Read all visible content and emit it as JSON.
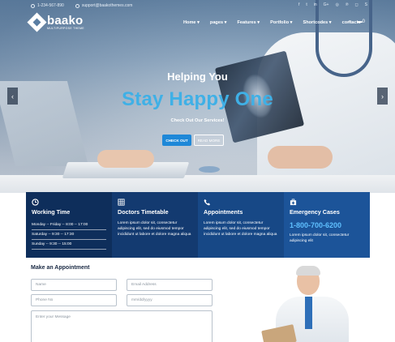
{
  "topbar": {
    "phone": "1-234-567-890",
    "email": "support@baakothemes.com",
    "social_icons": [
      "facebook-icon",
      "twitter-icon",
      "linkedin-icon",
      "google-plus-icon",
      "github-icon",
      "pinterest-icon",
      "instagram-icon",
      "skype-icon"
    ],
    "social_glyphs": [
      "f",
      "t",
      "in",
      "G+",
      "◎",
      "℗",
      "◻",
      "S"
    ]
  },
  "logo": {
    "name": "baako",
    "tagline": "MULTIPURPOSE THEME"
  },
  "nav": {
    "items": [
      "Home ▾",
      "pages ▾",
      "Features ▾",
      "Portfolio ▾",
      "Shortcodes ▾",
      "contacts"
    ],
    "cart_count": "0",
    "search_glyph": "⌕",
    "cart_glyph": "🛒"
  },
  "hero": {
    "subtitle": "Helping You",
    "title": "Stay Happy One",
    "cta_text": "Check Out Our Services!",
    "btn_primary": "CHECK OUT",
    "btn_secondary": "READ MORE",
    "prev_glyph": "‹",
    "next_glyph": "›"
  },
  "info": {
    "working": {
      "title": "Working Time",
      "rows": [
        "Monday -- Friday -- 8:00 -- 17:00",
        "Saturday -- 9:30 -- 17:30",
        "Sunday -- 9:30 -- 15:00"
      ]
    },
    "timetable": {
      "title": "Doctors Timetable",
      "text": "Lorem ipsum dolor sit, consectetur adipiscing elit, sed do eiusmod tempor incididunt ut labore et dolore magna aliqua"
    },
    "appointments": {
      "title": "Appointments",
      "text": "Lorem ipsum dolor sit, consectetur adipiscing elit, sed do eiusmod tempor incididunt ut labore et dolore magna aliqua"
    },
    "emergency": {
      "title": "Emergency Cases",
      "phone": "1-800-700-6200",
      "text": "Lorem ipsum dolor sit, consectetur adipiscing elit"
    }
  },
  "appointment": {
    "title": "Make an Appointment",
    "name_ph": "Name",
    "email_ph": "Email Address",
    "phone_ph": "Phone No",
    "date_ph": "mm/dd/yyyy",
    "message_ph": "Enter your Message"
  },
  "colors": {
    "accent": "#3fb0e6",
    "primary": "#1e88d8",
    "navy": "#0e2e5b"
  }
}
